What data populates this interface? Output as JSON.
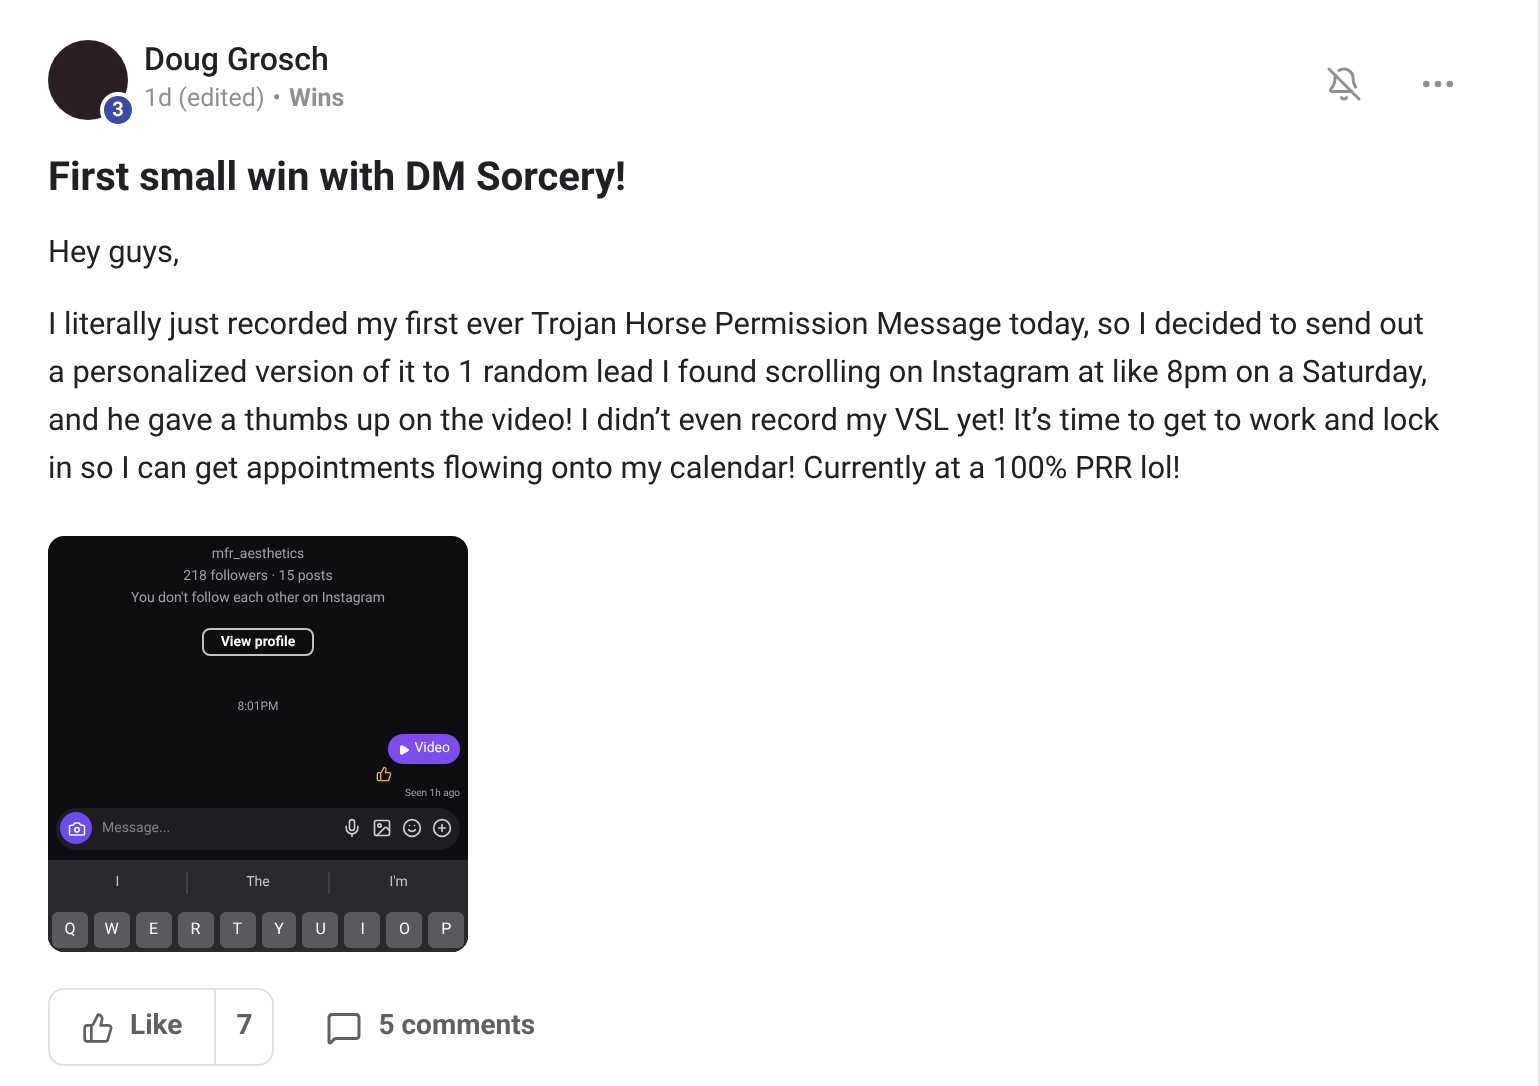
{
  "post": {
    "author": {
      "name": "Doug Grosch",
      "level_badge": "3"
    },
    "meta": {
      "time": "1d (edited)",
      "separator": "•",
      "category": "Wins"
    },
    "title": "First small win with DM Sorcery!",
    "paragraphs": [
      "Hey guys,",
      "I literally just recorded my first ever Trojan Horse Permission Message today, so I decided to send out a personalized version of it to 1 random lead I found scrolling on Instagram at like 8pm on a Saturday, and he gave a thumbs up on the video! I didn’t even record my VSL yet! It’s time to get to work and lock in so I can get appointments flowing onto my calendar! Currently at a 100% PRR lol!"
    ],
    "attachment": {
      "handle": "mfr_aesthetics",
      "stats": "218 followers · 15 posts",
      "follow_note": "You don't follow each other on Instagram",
      "view_profile": "View profile",
      "time": "8:01PM",
      "video_bubble": "Video",
      "seen": "Seen 1h ago",
      "message_placeholder": "Message...",
      "suggestions": [
        "I",
        "The",
        "I'm"
      ],
      "keys": [
        "Q",
        "W",
        "E",
        "R",
        "T",
        "Y",
        "U",
        "I",
        "O",
        "P"
      ]
    },
    "actions": {
      "like": "Like",
      "like_count": "7",
      "comments": "5 comments"
    }
  }
}
